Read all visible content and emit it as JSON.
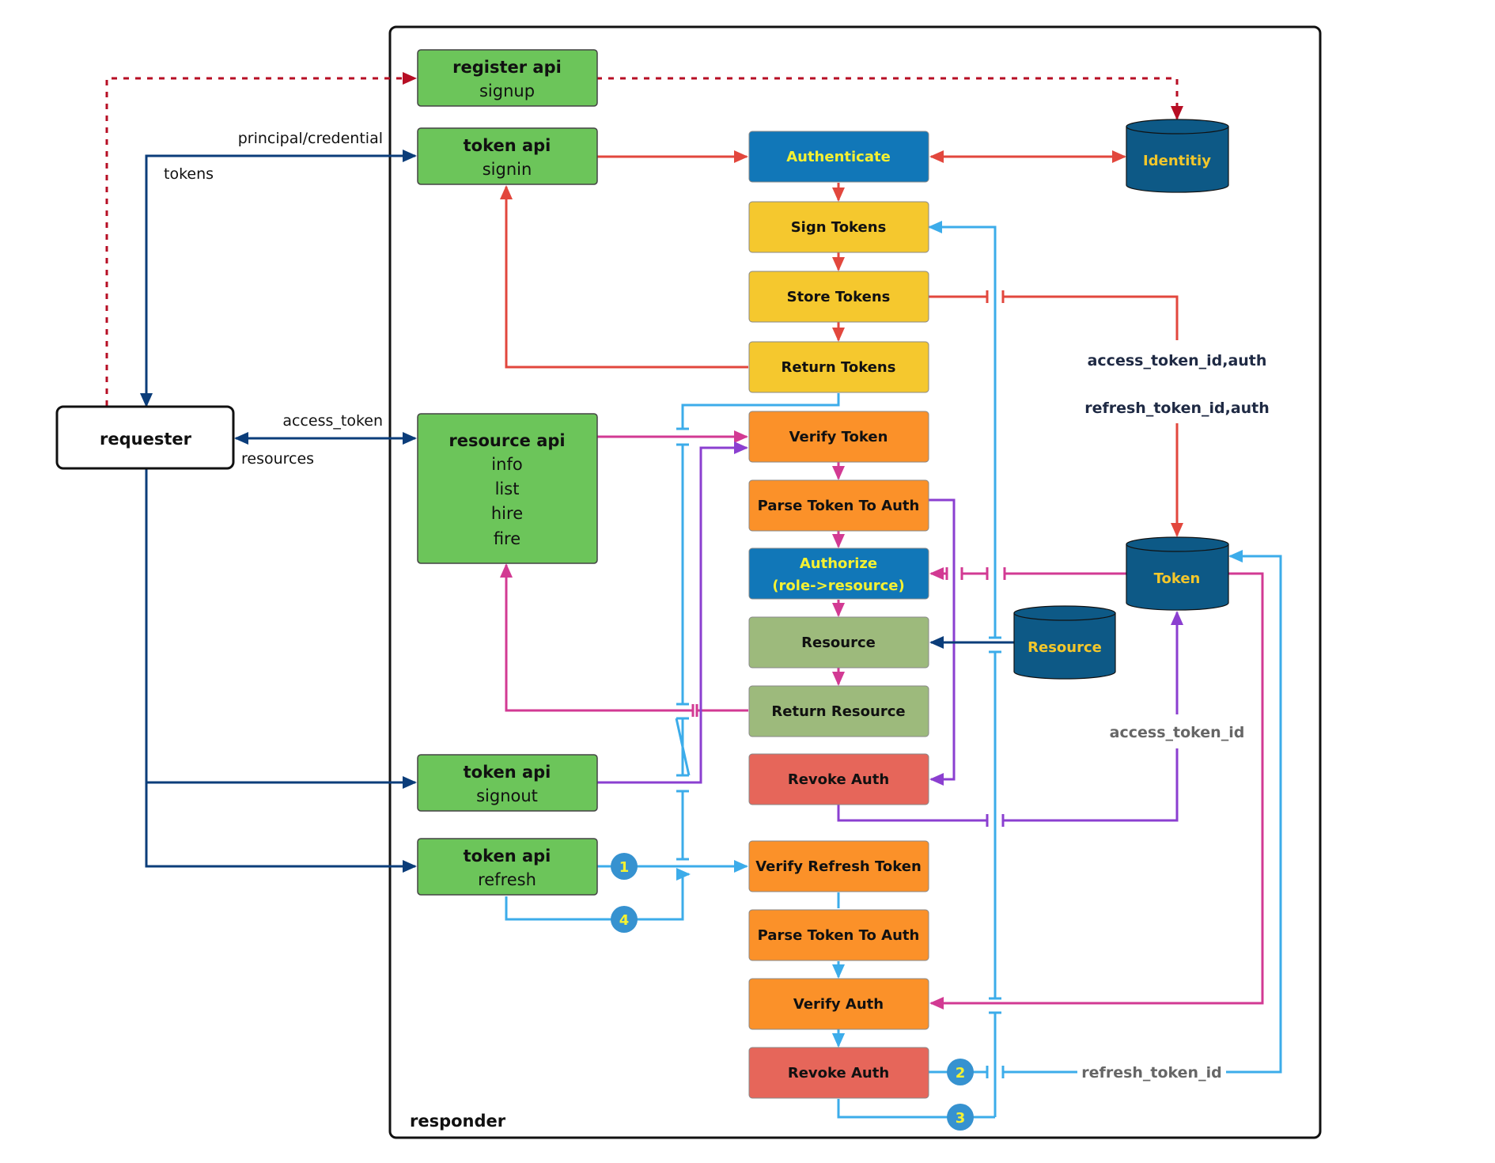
{
  "colors": {
    "api_green": "#6cc55a",
    "auth_blue": "#1177b8",
    "token_yellow": "#f5c82e",
    "verify_orange": "#fb9129",
    "resource_green": "#9dba7c",
    "revoke_red": "#e6665a",
    "db_blue": "#0d5986",
    "line_red": "#e2473d",
    "line_darkred": "#b70e24",
    "line_navy": "#0b3d7a",
    "line_magenta": "#d23a93",
    "line_purple": "#8b3fd0",
    "line_lightblue": "#3cacea",
    "badge_blue": "#3692d0"
  },
  "containers": {
    "responder_label": "responder"
  },
  "requester": {
    "label": "requester"
  },
  "apis": {
    "register": {
      "title": "register api",
      "lines": [
        "signup"
      ]
    },
    "signin": {
      "title": "token api",
      "lines": [
        "signin"
      ]
    },
    "resource": {
      "title": "resource api",
      "lines": [
        "info",
        "list",
        "hire",
        "fire"
      ]
    },
    "signout": {
      "title": "token api",
      "lines": [
        "signout"
      ]
    },
    "refresh": {
      "title": "token api",
      "lines": [
        "refresh"
      ]
    }
  },
  "steps": {
    "authenticate": "Authenticate",
    "sign_tokens": "Sign Tokens",
    "store_tokens": "Store Tokens",
    "return_tokens": "Return Tokens",
    "verify_token": "Verify Token",
    "parse_token_1": "Parse Token To Auth",
    "authorize_1": "Authorize",
    "authorize_2": "(role->resource)",
    "resource": "Resource",
    "return_resource": "Return Resource",
    "revoke_auth_1": "Revoke Auth",
    "verify_refresh_token": "Verify Refresh Token",
    "parse_token_2": "Parse Token To Auth",
    "verify_auth": "Verify Auth",
    "revoke_auth_2": "Revoke Auth"
  },
  "databases": {
    "identity": "Identitiy",
    "token": "Token",
    "resource": "Resource"
  },
  "edge_labels": {
    "principal_credential": "principal/credential",
    "tokens": "tokens",
    "access_token": "access_token",
    "resources": "resources",
    "access_token_id_auth": "access_token_id,auth",
    "refresh_token_id_auth": "refresh_token_id,auth",
    "access_token_id": "access_token_id",
    "refresh_token_id": "refresh_token_id"
  },
  "badges": [
    "1",
    "2",
    "3",
    "4"
  ]
}
